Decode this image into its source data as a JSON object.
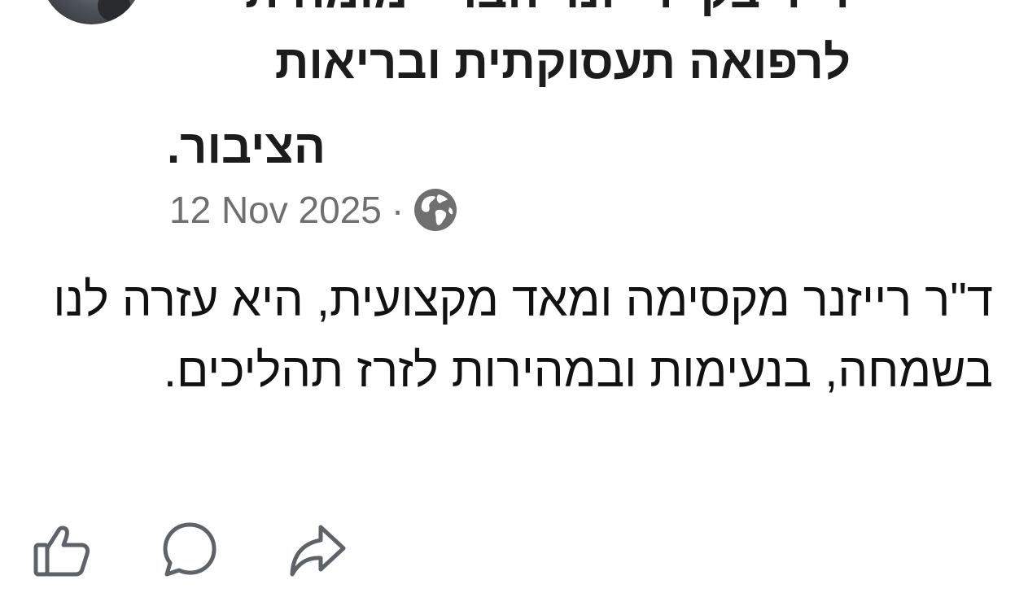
{
  "author": {
    "name_lines": "ד\"ר בקי רייזנר הבר - מומחית לרפואה תעסוקתית ובריאות",
    "name_tail": "הציבור."
  },
  "meta": {
    "date": "12 Nov 2025",
    "separator": "·",
    "audience_icon": "globe-icon"
  },
  "post": {
    "text": "ד\"ר רייזנר מקסימה ומאד מקצועית, היא עזרה לנו בשמחה, בנעימות ובמהירות לזרז תהליכים."
  },
  "actions": {
    "icons": [
      "like-icon",
      "comment-icon",
      "share-icon"
    ]
  },
  "colors": {
    "text": "#111111",
    "meta": "#6f6f6f",
    "icon_stroke": "#5f6368"
  }
}
